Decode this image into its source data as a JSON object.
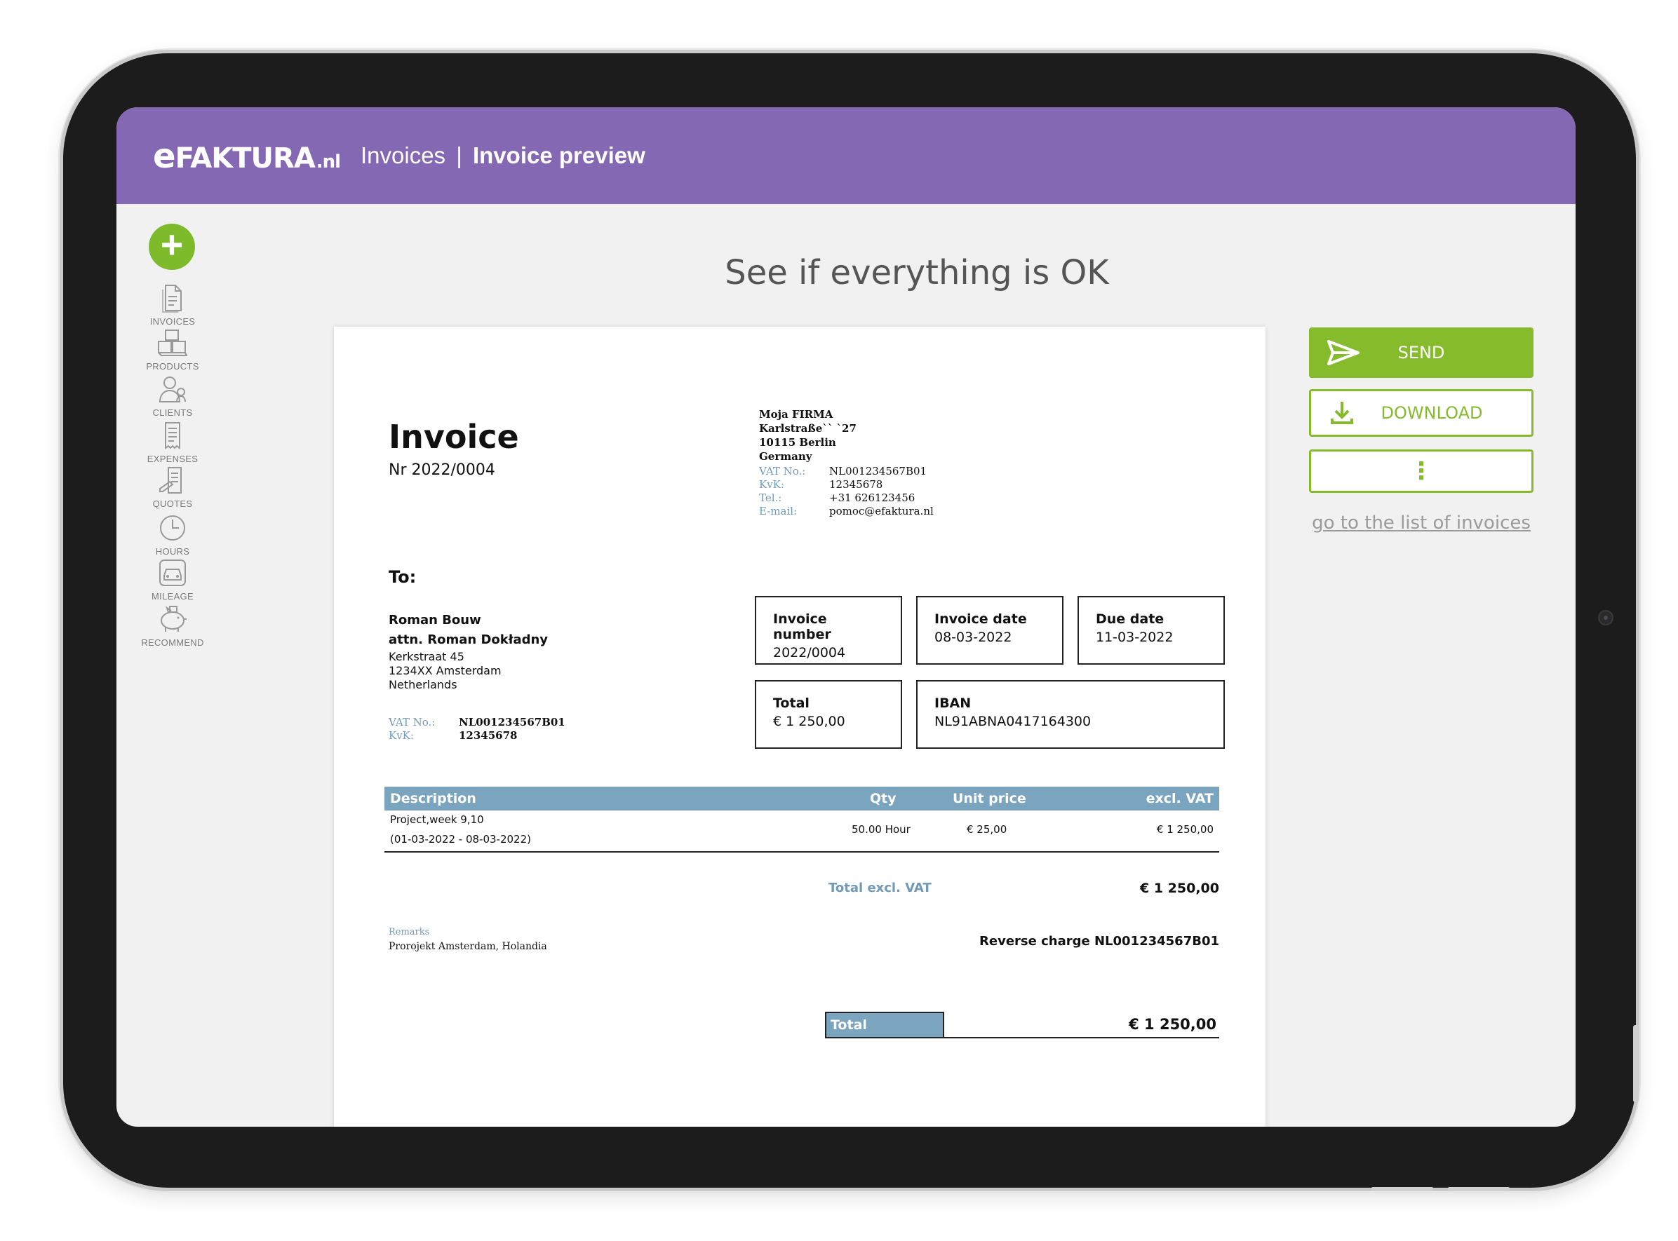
{
  "header": {
    "logo_e": "e",
    "logo_main": "FAKTURA",
    "logo_tld": ".nl",
    "breadcrumb_parent": "Invoices",
    "breadcrumb_separator": "|",
    "breadcrumb_current": "Invoice preview",
    "bar_color": "#8568b3"
  },
  "sidebar": {
    "add_symbol": "+",
    "items": [
      {
        "label": "INVOICES",
        "icon": "invoice-document-icon"
      },
      {
        "label": "PRODUCTS",
        "icon": "boxes-icon"
      },
      {
        "label": "CLIENTS",
        "icon": "clients-icon"
      },
      {
        "label": "EXPENSES",
        "icon": "receipt-icon"
      },
      {
        "label": "QUOTES",
        "icon": "quote-document-icon"
      },
      {
        "label": "HOURS",
        "icon": "clock-icon"
      },
      {
        "label": "MILEAGE",
        "icon": "car-icon"
      },
      {
        "label": "RECOMMEND",
        "icon": "piggy-bank-icon"
      }
    ]
  },
  "main": {
    "heading": "See if everything is OK"
  },
  "invoice": {
    "title": "Invoice",
    "number_line": "Nr 2022/0004",
    "seller": {
      "name": "Moja FIRMA",
      "street": "Karlstraße`` `27",
      "city": "10115 Berlin",
      "country": "Germany",
      "fields": [
        {
          "k": "VAT No.:",
          "v": "NL001234567B01"
        },
        {
          "k": "KvK:",
          "v": "12345678"
        },
        {
          "k": "Tel.:",
          "v": "+31 626123456"
        },
        {
          "k": "E-mail:",
          "v": "pomoc@efaktura.nl"
        }
      ]
    },
    "to_label": "To:",
    "buyer": {
      "name": "Roman Bouw",
      "attn": "attn. Roman Dokładny",
      "street": "Kerkstraat 45",
      "city": "1234XX Amsterdam",
      "country": "Netherlands",
      "fields": [
        {
          "k": "VAT No.:",
          "v": "NL001234567B01"
        },
        {
          "k": "KvK:",
          "v": "12345678"
        }
      ]
    },
    "boxes": {
      "invoice_number_label": "Invoice number",
      "invoice_number_value": "2022/0004",
      "invoice_date_label": "Invoice date",
      "invoice_date_value": "08-03-2022",
      "due_date_label": "Due date",
      "due_date_value": "11-03-2022",
      "total_label": "Total",
      "total_value": "€ 1 250,00",
      "iban_label": "IBAN",
      "iban_value": "NL91ABNA0417164300"
    },
    "table": {
      "headers": {
        "description": "Description",
        "qty": "Qty",
        "unit_price": "Unit price",
        "excl_vat": "excl. VAT"
      },
      "rows": [
        {
          "description_1": "Project,week  9,10",
          "description_2": "(01-03-2022 - 08-03-2022)",
          "qty": "50.00 Hour",
          "unit_price": "€ 25,00",
          "excl_vat": "€ 1 250,00"
        }
      ]
    },
    "total_excl_label": "Total excl. VAT",
    "total_excl_value": "€ 1 250,00",
    "remarks_label": "Remarks",
    "remarks_value": "Prorojekt Amsterdam, Holandia",
    "reverse_charge": "Reverse charge NL001234567B01",
    "grand_total_label": "Total",
    "grand_total_value": "€ 1 250,00",
    "accent_color": "#7ba4be"
  },
  "actions": {
    "send_label": "SEND",
    "download_label": "DOWNLOAD",
    "more_label": "⋮",
    "go_list_label": "go to the list of invoices",
    "accent_color": "#86bb2c"
  }
}
